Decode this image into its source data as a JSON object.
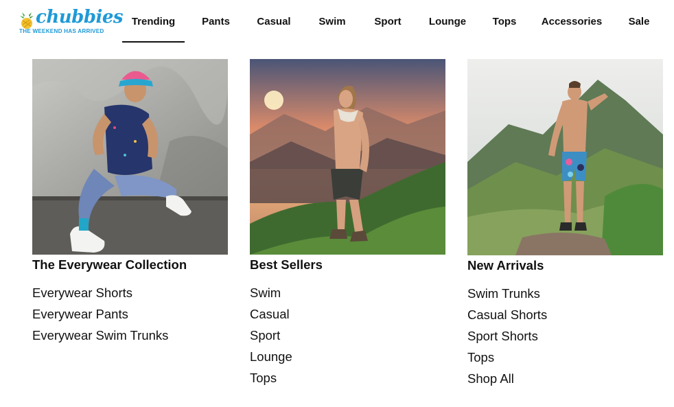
{
  "brand": {
    "wordmark": "chubbies",
    "tagline": "THE WEEKEND HAS ARRIVED",
    "color": "#1f9ad6"
  },
  "nav": {
    "items": [
      {
        "label": "Trending",
        "active": true
      },
      {
        "label": "Pants",
        "active": false
      },
      {
        "label": "Casual",
        "active": false
      },
      {
        "label": "Swim",
        "active": false
      },
      {
        "label": "Sport",
        "active": false
      },
      {
        "label": "Lounge",
        "active": false
      },
      {
        "label": "Tops",
        "active": false
      },
      {
        "label": "Accessories",
        "active": false
      },
      {
        "label": "Sale",
        "active": false
      }
    ]
  },
  "columns": [
    {
      "title": "The Everywear Collection",
      "links": [
        "Everywear Shorts",
        "Everywear Pants",
        "Everywear Swim Trunks"
      ]
    },
    {
      "title": "Best Sellers",
      "links": [
        "Swim",
        "Casual",
        "Sport",
        "Lounge",
        "Tops"
      ]
    },
    {
      "title": "New Arrivals",
      "links": [
        "Swim Trunks",
        "Casual Shorts",
        "Sport Shorts",
        "Tops",
        "Shop All"
      ]
    }
  ]
}
